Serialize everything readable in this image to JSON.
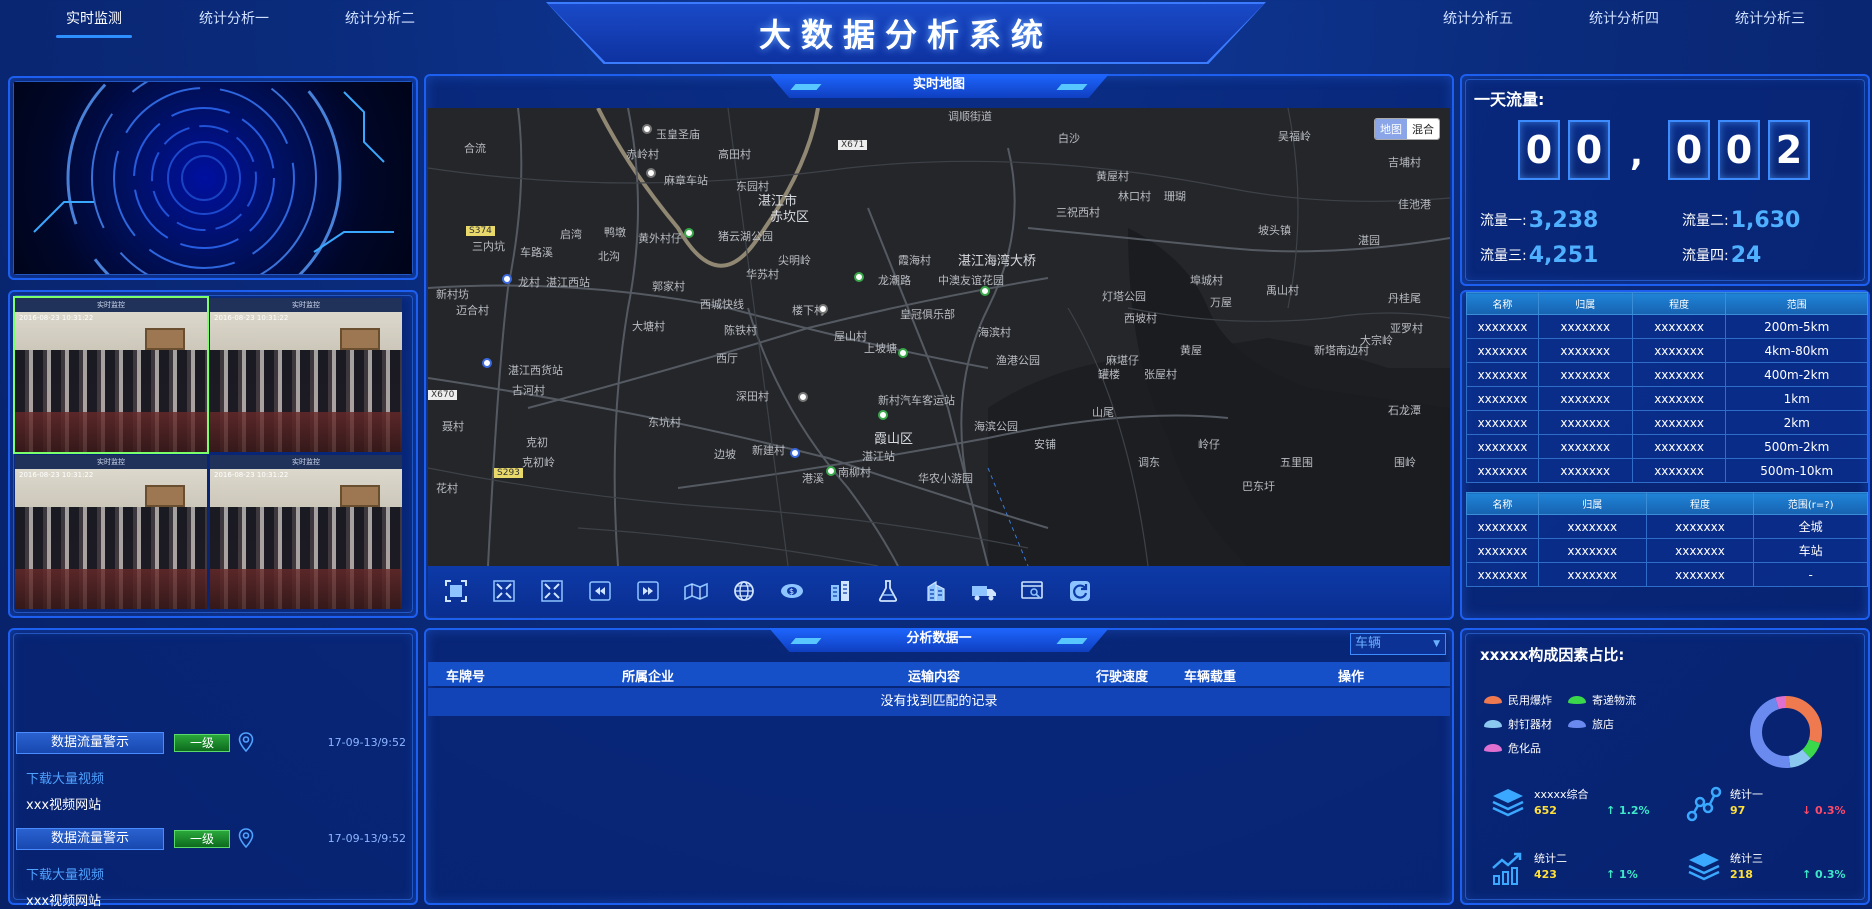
{
  "nav": {
    "left": [
      "实时监测",
      "统计分析一",
      "统计分析二"
    ],
    "right": [
      "统计分析五",
      "统计分析四",
      "统计分析三"
    ],
    "title": "大数据分析系统"
  },
  "cameras": {
    "header": "实时监控",
    "timestamp": "2016-08-23 10:31:22"
  },
  "map_panel": {
    "title": "实时地图",
    "toggle": [
      "地图",
      "混合"
    ],
    "labels": [
      "调顺街道",
      "玉皇圣庙",
      "合流",
      "赤岭村",
      "高田村",
      "X671",
      "白沙",
      "吴福岭",
      "吉埔村",
      "麻章车站",
      "东园村",
      "湛江市",
      "赤坎区",
      "黄屋村",
      "林口村",
      "珊瑚",
      "佳池港",
      "三祝西村",
      "S374",
      "三内坑",
      "启湾",
      "鸭墩",
      "黄外村仔",
      "猪云湖公园",
      "坡头镇",
      "湛园",
      "车路溪",
      "北沟",
      "尖明岭",
      "霞海村",
      "湛江海湾大桥",
      "龙潮路",
      "龙村",
      "湛江西站",
      "郭家村",
      "华苏村",
      "中澳友谊花园",
      "灯塔公园",
      "埠城村",
      "万屋",
      "禹山村",
      "丹桂尾",
      "新村坊",
      "迈合村",
      "西城快线",
      "楼下村",
      "皇冠俱乐部",
      "西坡村",
      "亚罗村",
      "大塘村",
      "陈铁村",
      "屋山村",
      "上坡塘",
      "海滨村",
      "黄屋",
      "新塔南边村",
      "大宗岭",
      "西厅",
      "渔港公园",
      "麻堪仔",
      "罐楼",
      "张屋村",
      "湛江西货站",
      "古河村",
      "X670",
      "深田村",
      "新村汽车客运站",
      "山尾",
      "石龙潭",
      "聂村",
      "东坑村",
      "海滨公园",
      "克初",
      "边坡",
      "新建村",
      "霞山区",
      "安铺",
      "调东",
      "岭仔",
      "五里围",
      "围岭",
      "克初岭",
      "湛江站",
      "南柳村",
      "S293",
      "港溪",
      "华农小游园",
      "巴东圩",
      "花村"
    ]
  },
  "flow": {
    "title": "一天流量:",
    "digits": [
      "0",
      "0",
      ",",
      "0",
      "0",
      "2"
    ],
    "items": [
      {
        "label": "流量一:",
        "value": "3,238"
      },
      {
        "label": "流量二:",
        "value": "1,630"
      },
      {
        "label": "流量三:",
        "value": "4,251"
      },
      {
        "label": "流量四:",
        "value": "24"
      }
    ]
  },
  "table1": {
    "headers": [
      "名称",
      "归属",
      "程度",
      "范围"
    ],
    "rows": [
      [
        "xxxxxxx",
        "xxxxxxx",
        "xxxxxxx",
        "200m-5km"
      ],
      [
        "xxxxxxx",
        "xxxxxxx",
        "xxxxxxx",
        "4km-80km"
      ],
      [
        "xxxxxxx",
        "xxxxxxx",
        "xxxxxxx",
        "400m-2km"
      ],
      [
        "xxxxxxx",
        "xxxxxxx",
        "xxxxxxx",
        "1km"
      ],
      [
        "xxxxxxx",
        "xxxxxxx",
        "xxxxxxx",
        "2km"
      ],
      [
        "xxxxxxx",
        "xxxxxxx",
        "xxxxxxx",
        "500m-2km"
      ],
      [
        "xxxxxxx",
        "xxxxxxx",
        "xxxxxxx",
        "500m-10km"
      ]
    ]
  },
  "table2": {
    "headers": [
      "名称",
      "归属",
      "程度",
      "范围(r=?)"
    ],
    "rows": [
      [
        "xxxxxxx",
        "xxxxxxx",
        "xxxxxxx",
        "全城"
      ],
      [
        "xxxxxxx",
        "xxxxxxx",
        "xxxxxxx",
        "车站"
      ],
      [
        "xxxxxxx",
        "xxxxxxx",
        "xxxxxxx",
        "-"
      ]
    ]
  },
  "analysis": {
    "title": "分析数据一",
    "select_value": "车辆",
    "columns": [
      "车牌号",
      "所属企业",
      "运输内容",
      "行驶速度",
      "车辆载重",
      "操作"
    ],
    "empty_text": "没有找到匹配的记录"
  },
  "alerts": [
    {
      "button": "数据流量警示",
      "level": "一级",
      "time": "17-09-13/9:52",
      "link": "下载大量视频",
      "site": "xxx视频网站"
    },
    {
      "button": "数据流量警示",
      "level": "一级",
      "time": "17-09-13/9:52",
      "link": "下载大量视频",
      "site": "xxx视频网站"
    }
  ],
  "composition": {
    "title": "xxxxx构成因素占比:",
    "legend": [
      {
        "name": "民用爆炸",
        "color": "#f07a50"
      },
      {
        "name": "寄递物流",
        "color": "#3ad84a"
      },
      {
        "name": "射钉器材",
        "color": "#8ac8f0"
      },
      {
        "name": "旅店",
        "color": "#6a8af0"
      },
      {
        "name": "危化品",
        "color": "#e070d0"
      }
    ],
    "donut": [
      {
        "name": "民用爆炸",
        "value": 30,
        "color": "#f07a50"
      },
      {
        "name": "寄递物流",
        "value": 8,
        "color": "#3ad84a"
      },
      {
        "name": "射钉器材",
        "value": 10,
        "color": "#8ac8f0"
      },
      {
        "name": "旅店",
        "value": 47,
        "color": "#6a8af0"
      },
      {
        "name": "危化品",
        "value": 5,
        "color": "#e070d0"
      }
    ],
    "stats": [
      {
        "label": "xxxxx综合",
        "value": "652",
        "change": "↑ 1.2%",
        "dir": "up",
        "icon": "layers-icon"
      },
      {
        "label": "统计一",
        "value": "97",
        "change": "↓ 0.3%",
        "dir": "down",
        "icon": "nodes-icon"
      },
      {
        "label": "统计二",
        "value": "423",
        "change": "↑ 1%",
        "dir": "up",
        "icon": "trend-bars-icon"
      },
      {
        "label": "统计三",
        "value": "218",
        "change": "↑ 0.3%",
        "dir": "up",
        "icon": "layers-icon"
      }
    ]
  }
}
